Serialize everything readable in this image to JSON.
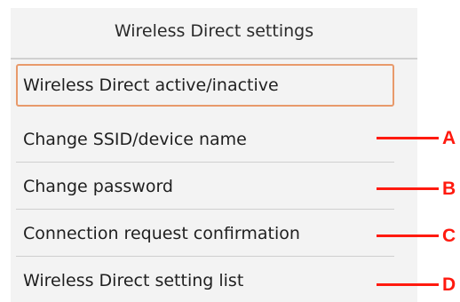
{
  "panel": {
    "title": "Wireless Direct settings",
    "items": [
      {
        "label": "Wireless Direct active/inactive",
        "selected": true
      },
      {
        "label": "Change SSID/device name",
        "callout": "A"
      },
      {
        "label": "Change password",
        "callout": "B"
      },
      {
        "label": "Connection request confirmation",
        "callout": "C"
      },
      {
        "label": "Wireless Direct setting list",
        "callout": "D"
      }
    ]
  },
  "colors": {
    "panel_bg": "#f3f3f3",
    "selection_border": "#e89a6b",
    "callout": "#ff1a0f"
  }
}
